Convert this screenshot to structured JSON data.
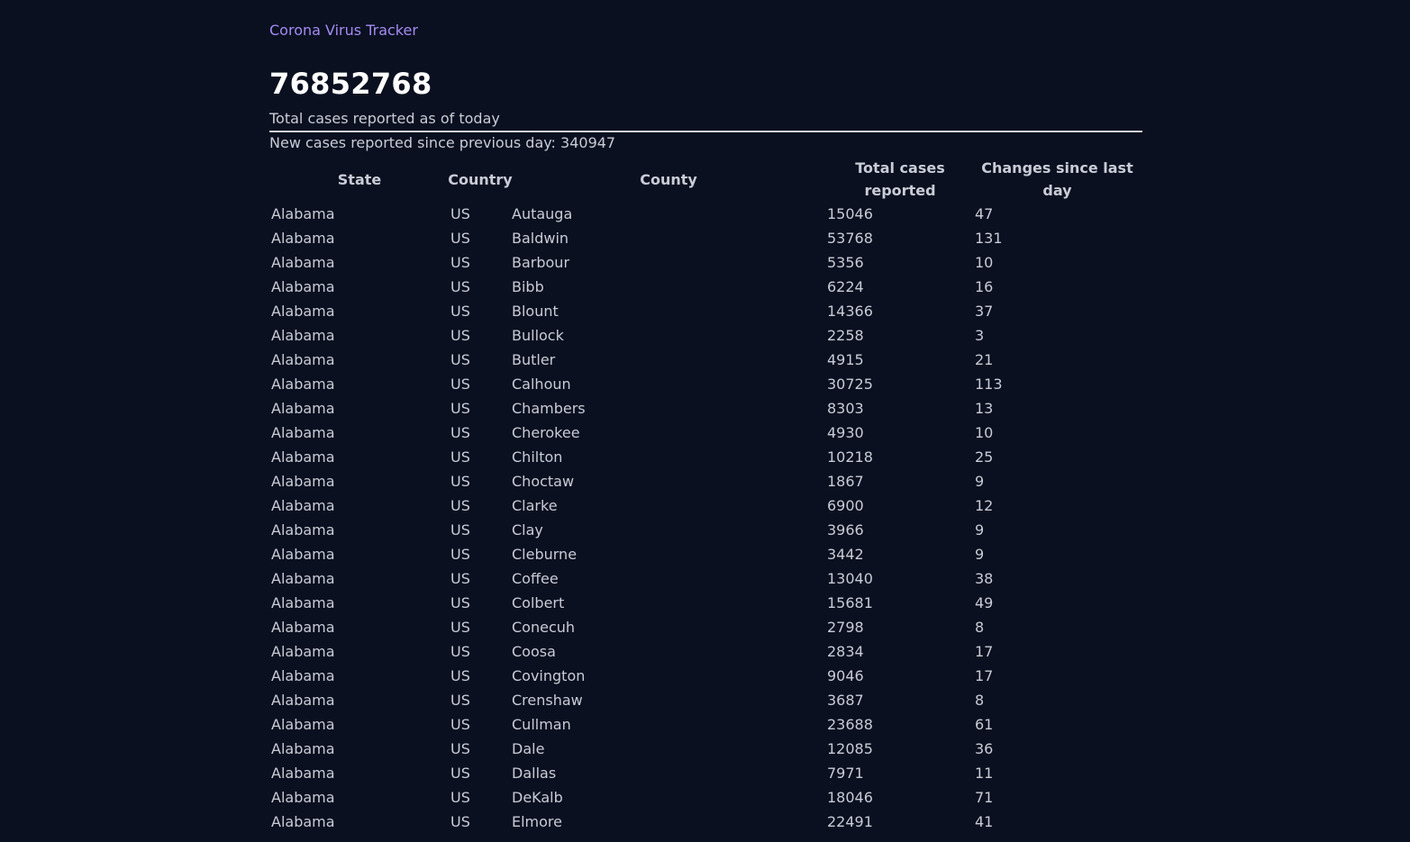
{
  "app": {
    "brand": "Corona Virus Tracker"
  },
  "summary": {
    "total_cases": "76852768",
    "total_label": "Total cases reported as of today",
    "new_cases_text": "New cases reported since previous day: 340947"
  },
  "table": {
    "headers": {
      "state": "State",
      "country": "Country",
      "county": "County",
      "total": "Total cases reported",
      "change": "Changes since last day"
    },
    "rows": [
      {
        "state": "Alabama",
        "country": "US",
        "county": "Autauga",
        "total": "15046",
        "change": "47"
      },
      {
        "state": "Alabama",
        "country": "US",
        "county": "Baldwin",
        "total": "53768",
        "change": "131"
      },
      {
        "state": "Alabama",
        "country": "US",
        "county": "Barbour",
        "total": "5356",
        "change": "10"
      },
      {
        "state": "Alabama",
        "country": "US",
        "county": "Bibb",
        "total": "6224",
        "change": "16"
      },
      {
        "state": "Alabama",
        "country": "US",
        "county": "Blount",
        "total": "14366",
        "change": "37"
      },
      {
        "state": "Alabama",
        "country": "US",
        "county": "Bullock",
        "total": "2258",
        "change": "3"
      },
      {
        "state": "Alabama",
        "country": "US",
        "county": "Butler",
        "total": "4915",
        "change": "21"
      },
      {
        "state": "Alabama",
        "country": "US",
        "county": "Calhoun",
        "total": "30725",
        "change": "113"
      },
      {
        "state": "Alabama",
        "country": "US",
        "county": "Chambers",
        "total": "8303",
        "change": "13"
      },
      {
        "state": "Alabama",
        "country": "US",
        "county": "Cherokee",
        "total": "4930",
        "change": "10"
      },
      {
        "state": "Alabama",
        "country": "US",
        "county": "Chilton",
        "total": "10218",
        "change": "25"
      },
      {
        "state": "Alabama",
        "country": "US",
        "county": "Choctaw",
        "total": "1867",
        "change": "9"
      },
      {
        "state": "Alabama",
        "country": "US",
        "county": "Clarke",
        "total": "6900",
        "change": "12"
      },
      {
        "state": "Alabama",
        "country": "US",
        "county": "Clay",
        "total": "3966",
        "change": "9"
      },
      {
        "state": "Alabama",
        "country": "US",
        "county": "Cleburne",
        "total": "3442",
        "change": "9"
      },
      {
        "state": "Alabama",
        "country": "US",
        "county": "Coffee",
        "total": "13040",
        "change": "38"
      },
      {
        "state": "Alabama",
        "country": "US",
        "county": "Colbert",
        "total": "15681",
        "change": "49"
      },
      {
        "state": "Alabama",
        "country": "US",
        "county": "Conecuh",
        "total": "2798",
        "change": "8"
      },
      {
        "state": "Alabama",
        "country": "US",
        "county": "Coosa",
        "total": "2834",
        "change": "17"
      },
      {
        "state": "Alabama",
        "country": "US",
        "county": "Covington",
        "total": "9046",
        "change": "17"
      },
      {
        "state": "Alabama",
        "country": "US",
        "county": "Crenshaw",
        "total": "3687",
        "change": "8"
      },
      {
        "state": "Alabama",
        "country": "US",
        "county": "Cullman",
        "total": "23688",
        "change": "61"
      },
      {
        "state": "Alabama",
        "country": "US",
        "county": "Dale",
        "total": "12085",
        "change": "36"
      },
      {
        "state": "Alabama",
        "country": "US",
        "county": "Dallas",
        "total": "7971",
        "change": "11"
      },
      {
        "state": "Alabama",
        "country": "US",
        "county": "DeKalb",
        "total": "18046",
        "change": "71"
      },
      {
        "state": "Alabama",
        "country": "US",
        "county": "Elmore",
        "total": "22491",
        "change": "41"
      }
    ]
  }
}
